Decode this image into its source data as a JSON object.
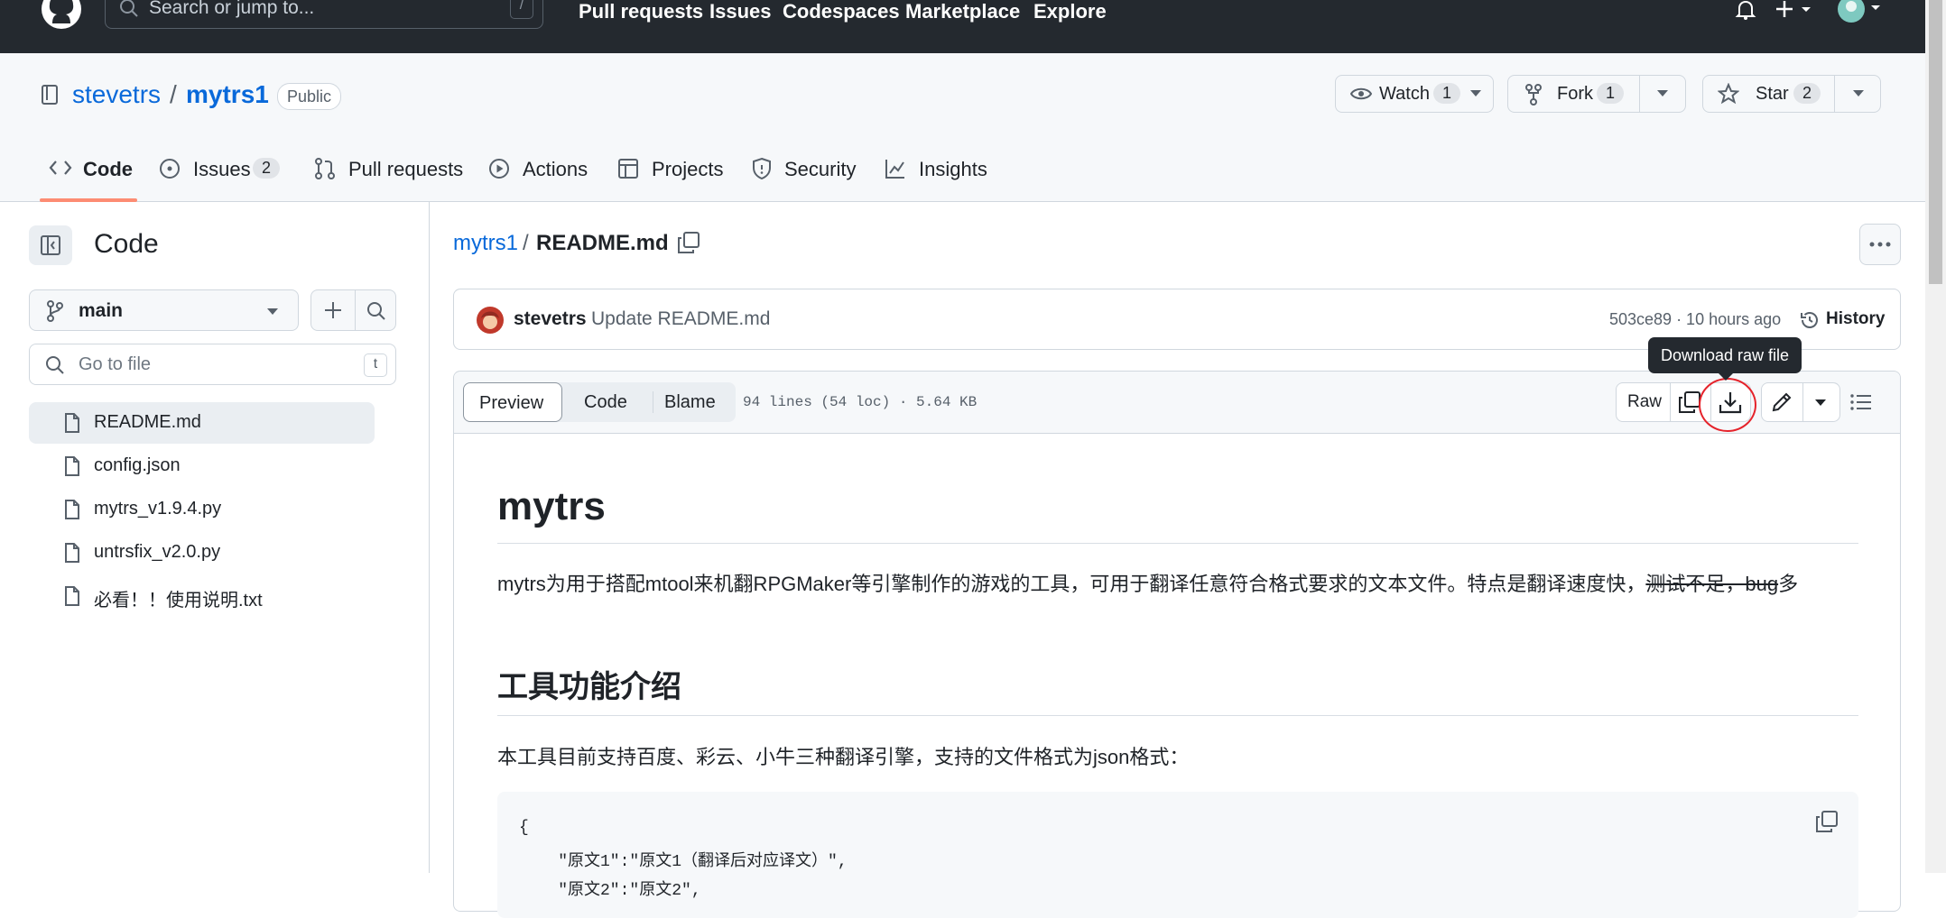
{
  "topnav": {
    "search_placeholder": "Search or jump to...",
    "search_shortcut": "/",
    "links": [
      "Pull requests",
      "Issues",
      "Codespaces",
      "Marketplace",
      "Explore"
    ]
  },
  "repo": {
    "owner": "stevetrs",
    "separator": "/",
    "name": "mytrs1",
    "visibility": "Public",
    "watch_label": "Watch",
    "watch_count": "1",
    "fork_label": "Fork",
    "fork_count": "1",
    "star_label": "Star",
    "star_count": "2"
  },
  "tabs": [
    {
      "label": "Code",
      "selected": true
    },
    {
      "label": "Issues",
      "count": "2"
    },
    {
      "label": "Pull requests"
    },
    {
      "label": "Actions"
    },
    {
      "label": "Projects"
    },
    {
      "label": "Security"
    },
    {
      "label": "Insights"
    }
  ],
  "sidebar": {
    "title": "Code",
    "branch": "main",
    "goto_placeholder": "Go to file",
    "goto_shortcut": "t",
    "files": [
      "README.md",
      "config.json",
      "mytrs_v1.9.4.py",
      "untrsfix_v2.0.py",
      "必看！！使用说明.txt"
    ]
  },
  "breadcrumb": {
    "repo": "mytrs1",
    "separator": "/",
    "file": "README.md"
  },
  "commit": {
    "author": "stevetrs",
    "message": "Update README.md",
    "meta": "503ce89 · 10 hours ago",
    "history_label": "History"
  },
  "filebar": {
    "tab_preview": "Preview",
    "tab_code": "Code",
    "tab_blame": "Blame",
    "info": "94 lines (54 loc) · 5.64 KB",
    "raw_label": "Raw",
    "tooltip": "Download raw file"
  },
  "readme": {
    "h1": "mytrs",
    "para1_normal": "mytrs为用于搭配mtool来机翻RPGMaker等引擎制作的游戏的工具，可用于翻译任意符合格式要求的文本文件。特点是翻译速度快，",
    "para1_strike": "测试不足，bug",
    "para1_tail": "多",
    "h2": "工具功能介绍",
    "para2": "本工具目前支持百度、彩云、小牛三种翻译引擎，支持的文件格式为json格式：",
    "code_line1": "{",
    "code_line2": "    \"原文1\":\"原文1（翻译后对应译文）\",",
    "code_line3": "    \"原文2\":\"原文2\","
  },
  "colors": {
    "nav_bg": "#24292f",
    "link_blue": "#0969da",
    "accent_orange": "#fd8c73",
    "highlight_red": "#e5232b"
  }
}
